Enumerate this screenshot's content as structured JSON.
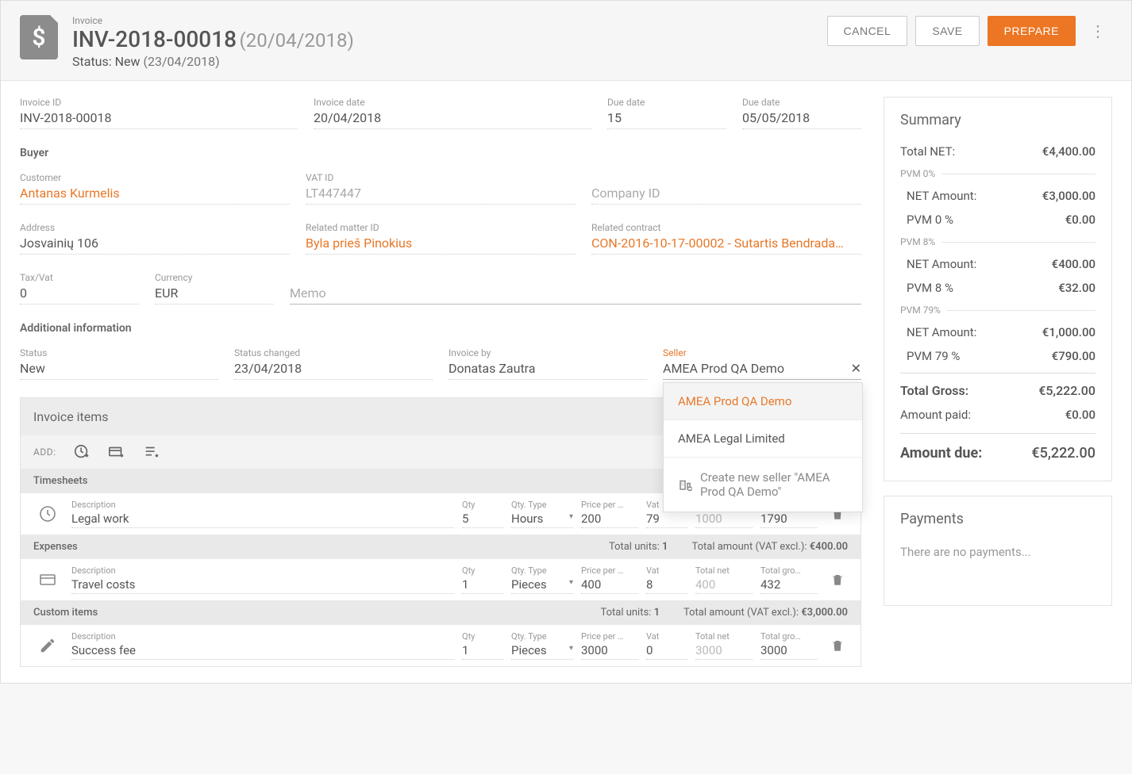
{
  "header": {
    "type_label": "Invoice",
    "title": "INV-2018-00018",
    "title_date": "(20/04/2018)",
    "status_label": "Status:",
    "status_value": "New",
    "status_date": "(23/04/2018)",
    "cancel": "CANCEL",
    "save": "SAVE",
    "prepare": "PREPARE"
  },
  "fields": {
    "invoice_id_label": "Invoice ID",
    "invoice_id": "INV-2018-00018",
    "invoice_date_label": "Invoice date",
    "invoice_date": "20/04/2018",
    "due_days_label": "Due date",
    "due_days": "15",
    "due_date_label": "Due date",
    "due_date": "05/05/2018",
    "buyer_title": "Buyer",
    "customer_label": "Customer",
    "customer": "Antanas Kurmelis",
    "vat_id_label": "VAT ID",
    "vat_id": "LT447447",
    "company_id_label": "Company ID",
    "company_id": "",
    "address_label": "Address",
    "address": "Josvainių 106",
    "matter_label": "Related matter ID",
    "matter": "Byla prieš Pinokius",
    "contract_label": "Related contract",
    "contract": "CON-2016-10-17-00002 - Sutartis Bendrada…",
    "taxvat_label": "Tax/Vat",
    "taxvat": "0",
    "currency_label": "Currency",
    "currency": "EUR",
    "memo_label": "",
    "memo_placeholder": "Memo",
    "addinfo_title": "Additional information",
    "status2_label": "Status",
    "status2": "New",
    "status_changed_label": "Status changed",
    "status_changed": "23/04/2018",
    "invoice_by_label": "Invoice by",
    "invoice_by": "Donatas Zautra",
    "seller_label": "Seller",
    "seller": "AMEA Prod QA Demo"
  },
  "dropdown": {
    "opt1": "AMEA Prod QA Demo",
    "opt2": "AMEA Legal Limited",
    "create": "Create new seller \"AMEA Prod QA Demo\""
  },
  "items": {
    "panel_title": "Invoice items",
    "add_label": "ADD:",
    "groups": {
      "timesheets": "Timesheets",
      "expenses": "Expenses",
      "expenses_units_label": "Total units:",
      "expenses_units": "1",
      "expenses_amt_label": "Total amount (VAT excl.):",
      "expenses_amt": "€400.00",
      "custom": "Custom items",
      "custom_units_label": "Total units:",
      "custom_units": "1",
      "custom_amt_label": "Total amount (VAT excl.):",
      "custom_amt": "€3,000.00"
    },
    "cols": {
      "desc": "Description",
      "qty": "Qty",
      "qtytype": "Qty. Type",
      "price": "Price per …",
      "vat": "Vat",
      "net": "Total net",
      "gross": "Total gro…"
    },
    "r1": {
      "desc": "Legal work",
      "qty": "5",
      "qtytype": "Hours",
      "price": "200",
      "vat": "79",
      "net": "1000",
      "gross": "1790"
    },
    "r2": {
      "desc": "Travel costs",
      "qty": "1",
      "qtytype": "Pieces",
      "price": "400",
      "vat": "8",
      "net": "400",
      "gross": "432"
    },
    "r3": {
      "desc": "Success fee",
      "qty": "1",
      "qtytype": "Pieces",
      "price": "3000",
      "vat": "0",
      "net": "3000",
      "gross": "3000"
    }
  },
  "summary": {
    "title": "Summary",
    "total_net_label": "Total NET:",
    "total_net": "€4,400.00",
    "g0_title": "PVM 0%",
    "g0_net_label": "NET Amount:",
    "g0_net": "€3,000.00",
    "g0_tax_label": "PVM 0 %",
    "g0_tax": "€0.00",
    "g8_title": "PVM 8%",
    "g8_net_label": "NET Amount:",
    "g8_net": "€400.00",
    "g8_tax_label": "PVM 8 %",
    "g8_tax": "€32.00",
    "g79_title": "PVM 79%",
    "g79_net_label": "NET Amount:",
    "g79_net": "€1,000.00",
    "g79_tax_label": "PVM 79 %",
    "g79_tax": "€790.00",
    "gross_label": "Total Gross:",
    "gross": "€5,222.00",
    "paid_label": "Amount paid:",
    "paid": "€0.00",
    "due_label": "Amount due:",
    "due": "€5,222.00"
  },
  "payments": {
    "title": "Payments",
    "empty": "There are no payments..."
  }
}
